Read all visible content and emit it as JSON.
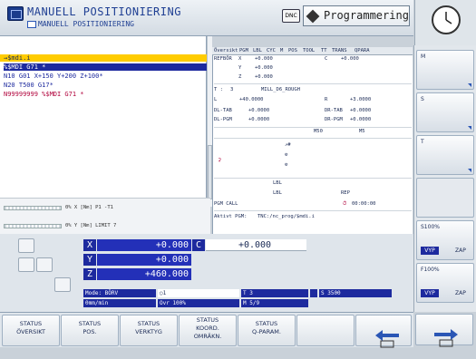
{
  "header": {
    "title": "MANUELL POSITIONIERING",
    "subtitle": "MANUELL POSITIONIERING",
    "dnc_label": "DNC",
    "programming_label": "Programmering"
  },
  "program": {
    "path": "→$mdi.i",
    "lines": [
      "%$MDI G71 *",
      "N10 G01 X+150 Y+200 Z+100*",
      "N20 T500 G17*",
      "N99999999 %$MDI G71 *"
    ]
  },
  "overrides": {
    "feed": "0% X [Nm]  P1  -T1",
    "rapid": "0% Y [Nm]  LIMIT 7"
  },
  "tabs": [
    "Översikt",
    "PGM",
    "LBL",
    "CYC",
    "M",
    "POS",
    "TOOL",
    "TT",
    "TRANS",
    "QPARA"
  ],
  "overview": {
    "ref_label": "REFBÖR",
    "x_label": "X",
    "x_val": "+0.000",
    "y_label": "Y",
    "y_val": "+0.000",
    "z_label": "Z",
    "z_val": "+0.000",
    "c_label": "C",
    "c_val": "+0.000",
    "tool_label": "T :",
    "tool_num": "3",
    "tool_name": "MILL_D6_ROUGH",
    "l_label": "L",
    "l_val": "+40.0000",
    "r_label": "R",
    "r_val": "+3.0000",
    "dltab_label": "DL-TAB",
    "dltab_val": "+0.0000",
    "drtab_label": "DR-TAB",
    "drtab_val": "+0.0000",
    "dlpgm_label": "DL-PGM",
    "dlpgm_val": "+0.0000",
    "drpgm_label": "DR-PGM",
    "drpgm_val": "+0.0000",
    "m50": "M50",
    "m5": "M5",
    "lbl1": "LBL",
    "lbl2": "LBL",
    "rep": "REP",
    "pgm_call": "PGM CALL",
    "timer": "00:00:00",
    "active_pgm_label": "Aktivt PGM:",
    "active_pgm": "TNC:/nc_prog/$mdi.i"
  },
  "positions": {
    "x_label": "X",
    "x_val": "+0.000",
    "c_label": "C",
    "c_val": "+0.000",
    "y_label": "Y",
    "y_val": "+0.000",
    "z_label": "Z",
    "z_val": "+460.000"
  },
  "statusbar": {
    "mode": "Mode: BÖRV",
    "t": "T 3",
    "s": "S 3500",
    "feed": "0mm/min",
    "ovr": "Ovr 100%",
    "m": "M 5/9"
  },
  "softkeys": [
    "STATUS\nÖVERSIKT",
    "STATUS\nPOS.",
    "STATUS\nVERKTYG",
    "STATUS\nKOORD.\nOMRÄKN.",
    "STATUS\nQ-PARAM.",
    "",
    ""
  ],
  "side": {
    "m": "M",
    "s": "S",
    "t": "T",
    "s100": "S100%",
    "f100": "F100%",
    "vyp": "VYP",
    "zap": "ZAP"
  }
}
